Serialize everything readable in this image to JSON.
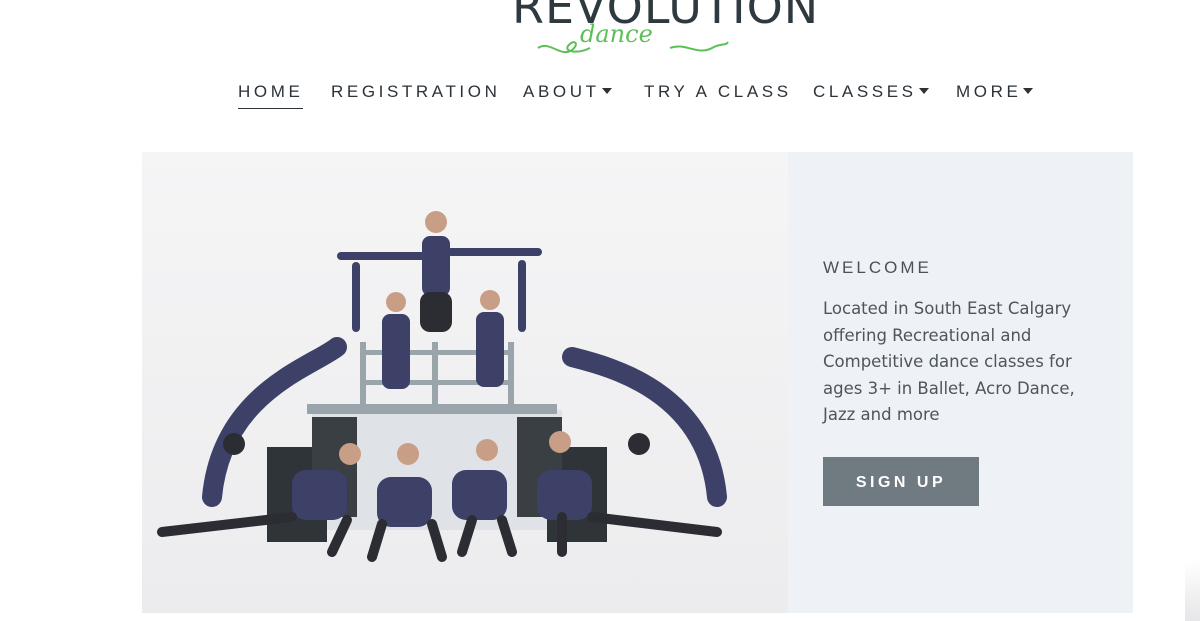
{
  "logo": {
    "wordmark": "REVOLUTION",
    "script": "dance",
    "colors": {
      "wordmark": "#2e3a40",
      "script": "#5cbf57"
    }
  },
  "nav": {
    "items": [
      {
        "label": "HOME",
        "active": true,
        "has_dropdown": false
      },
      {
        "label": "REGISTRATION",
        "active": false,
        "has_dropdown": false
      },
      {
        "label": "ABOUT",
        "active": false,
        "has_dropdown": true
      },
      {
        "label": "TRY A CLASS",
        "active": false,
        "has_dropdown": false
      },
      {
        "label": "CLASSES",
        "active": false,
        "has_dropdown": true
      },
      {
        "label": "MORE",
        "active": false,
        "has_dropdown": true
      }
    ]
  },
  "hero": {
    "image_subject": "dance-group-photo",
    "heading": "WELCOME",
    "description": "Located in South East Calgary offering Recreational and Competitive dance classes for ages 3+ in Ballet, Acro Dance, Jazz and more",
    "cta_label": "SIGN UP",
    "colors": {
      "panel_bg": "#eef1f5",
      "cta_bg": "#707a81",
      "cta_text": "#ffffff"
    }
  }
}
